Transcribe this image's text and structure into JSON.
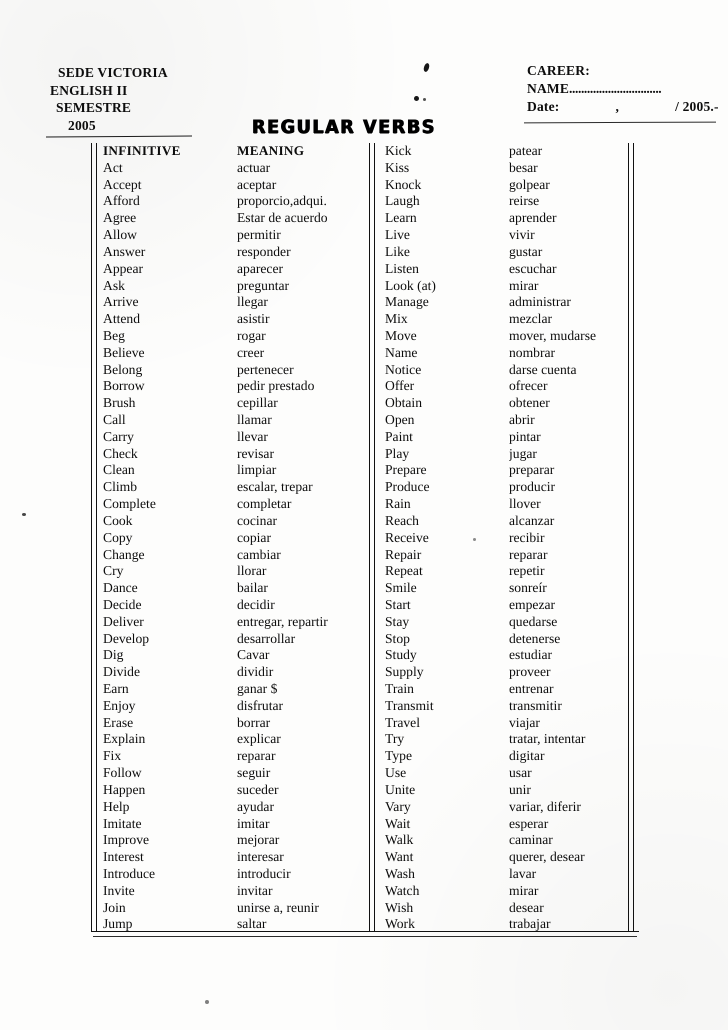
{
  "header": {
    "left_lines": [
      "SEDE VICTORIA",
      "ENGLISH  II",
      "SEMESTRE",
      "2005"
    ],
    "career_label": "CAREER:",
    "name_label": "NAME",
    "name_dots": "...............................",
    "date_label": "Date:",
    "date_comma": ",",
    "date_year": "/ 2005.-"
  },
  "title": "REGULAR VERBS",
  "table": {
    "headers": {
      "infinitive": "INFINITIVE",
      "meaning": "MEANING"
    },
    "left_column": [
      {
        "term": "Act",
        "meaning": "actuar"
      },
      {
        "term": "Accept",
        "meaning": "aceptar"
      },
      {
        "term": "Afford",
        "meaning": "proporcio,adqui."
      },
      {
        "term": "Agree",
        "meaning": "Estar de acuerdo"
      },
      {
        "term": "Allow",
        "meaning": "permitir"
      },
      {
        "term": "Answer",
        "meaning": "responder"
      },
      {
        "term": "Appear",
        "meaning": "aparecer"
      },
      {
        "term": "Ask",
        "meaning": "preguntar"
      },
      {
        "term": "Arrive",
        "meaning": "llegar"
      },
      {
        "term": "Attend",
        "meaning": "asistir"
      },
      {
        "term": "Beg",
        "meaning": "rogar"
      },
      {
        "term": "Believe",
        "meaning": "creer"
      },
      {
        "term": "Belong",
        "meaning": "pertenecer"
      },
      {
        "term": "Borrow",
        "meaning": "pedir prestado"
      },
      {
        "term": "Brush",
        "meaning": "cepillar"
      },
      {
        "term": "Call",
        "meaning": "llamar"
      },
      {
        "term": "Carry",
        "meaning": "llevar"
      },
      {
        "term": "Check",
        "meaning": "revisar"
      },
      {
        "term": "Clean",
        "meaning": "limpiar"
      },
      {
        "term": "Climb",
        "meaning": "escalar, trepar"
      },
      {
        "term": "Complete",
        "meaning": "completar"
      },
      {
        "term": "Cook",
        "meaning": "cocinar"
      },
      {
        "term": "Copy",
        "meaning": "copiar"
      },
      {
        "term": "Change",
        "meaning": "cambiar"
      },
      {
        "term": "Cry",
        "meaning": "llorar"
      },
      {
        "term": "Dance",
        "meaning": "bailar"
      },
      {
        "term": "Decide",
        "meaning": "decidir"
      },
      {
        "term": "Deliver",
        "meaning": "entregar, repartir"
      },
      {
        "term": "Develop",
        "meaning": "desarrollar"
      },
      {
        "term": "Dig",
        "meaning": "Cavar"
      },
      {
        "term": "Divide",
        "meaning": "dividir"
      },
      {
        "term": "Earn",
        "meaning": "ganar $"
      },
      {
        "term": "Enjoy",
        "meaning": "disfrutar"
      },
      {
        "term": "Erase",
        "meaning": "borrar"
      },
      {
        "term": "Explain",
        "meaning": "explicar"
      },
      {
        "term": "Fix",
        "meaning": "reparar"
      },
      {
        "term": "Follow",
        "meaning": "seguir"
      },
      {
        "term": "Happen",
        "meaning": "suceder"
      },
      {
        "term": "Help",
        "meaning": "ayudar"
      },
      {
        "term": "Imitate",
        "meaning": "imitar"
      },
      {
        "term": "Improve",
        "meaning": "mejorar"
      },
      {
        "term": "Interest",
        "meaning": "interesar"
      },
      {
        "term": "Introduce",
        "meaning": "introducir"
      },
      {
        "term": "Invite",
        "meaning": "invitar"
      },
      {
        "term": "Join",
        "meaning": "unirse a, reunir"
      },
      {
        "term": "Jump",
        "meaning": "saltar"
      }
    ],
    "right_column": [
      {
        "term": "Kick",
        "meaning": "patear"
      },
      {
        "term": "Kiss",
        "meaning": "besar"
      },
      {
        "term": "Knock",
        "meaning": "golpear"
      },
      {
        "term": "Laugh",
        "meaning": "reirse"
      },
      {
        "term": "Learn",
        "meaning": "aprender"
      },
      {
        "term": "Live",
        "meaning": "vivir"
      },
      {
        "term": "Like",
        "meaning": "gustar"
      },
      {
        "term": "Listen",
        "meaning": "escuchar"
      },
      {
        "term": "Look  (at)",
        "meaning": "mirar"
      },
      {
        "term": "Manage",
        "meaning": "administrar"
      },
      {
        "term": "Mix",
        "meaning": "mezclar"
      },
      {
        "term": "Move",
        "meaning": "mover, mudarse"
      },
      {
        "term": "Name",
        "meaning": "nombrar"
      },
      {
        "term": "Notice",
        "meaning": "darse cuenta"
      },
      {
        "term": "Offer",
        "meaning": "ofrecer"
      },
      {
        "term": "Obtain",
        "meaning": "obtener"
      },
      {
        "term": "Open",
        "meaning": "abrir"
      },
      {
        "term": "Paint",
        "meaning": "pintar"
      },
      {
        "term": "Play",
        "meaning": "jugar"
      },
      {
        "term": "Prepare",
        "meaning": "preparar"
      },
      {
        "term": "Produce",
        "meaning": "producir"
      },
      {
        "term": "Rain",
        "meaning": "llover"
      },
      {
        "term": "Reach",
        "meaning": "alcanzar"
      },
      {
        "term": "Receive",
        "meaning": "recibir"
      },
      {
        "term": "Repair",
        "meaning": "reparar"
      },
      {
        "term": "Repeat",
        "meaning": "repetir"
      },
      {
        "term": "Smile",
        "meaning": "sonreír"
      },
      {
        "term": "Start",
        "meaning": "empezar"
      },
      {
        "term": "Stay",
        "meaning": "quedarse"
      },
      {
        "term": "Stop",
        "meaning": "detenerse"
      },
      {
        "term": "Study",
        "meaning": "estudiar"
      },
      {
        "term": "Supply",
        "meaning": "proveer"
      },
      {
        "term": "Train",
        "meaning": "entrenar"
      },
      {
        "term": "Transmit",
        "meaning": "transmitir"
      },
      {
        "term": "Travel",
        "meaning": "viajar"
      },
      {
        "term": "Try",
        "meaning": "tratar, intentar"
      },
      {
        "term": "Type",
        "meaning": "digitar"
      },
      {
        "term": "Use",
        "meaning": "usar"
      },
      {
        "term": "Unite",
        "meaning": "unir"
      },
      {
        "term": "Vary",
        "meaning": "variar, diferir"
      },
      {
        "term": "Wait",
        "meaning": "esperar"
      },
      {
        "term": "Walk",
        "meaning": "caminar"
      },
      {
        "term": "Want",
        "meaning": "querer, desear"
      },
      {
        "term": "Wash",
        "meaning": "lavar"
      },
      {
        "term": "Watch",
        "meaning": "mirar"
      },
      {
        "term": "Wish",
        "meaning": "desear"
      },
      {
        "term": "Work",
        "meaning": "trabajar"
      }
    ]
  }
}
